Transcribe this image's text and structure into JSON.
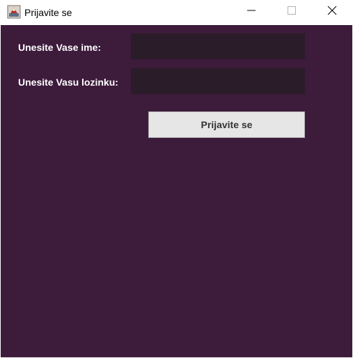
{
  "window": {
    "title": "Prijavite se",
    "icon": "java-app-icon",
    "controls": [
      "minimize-icon",
      "maximize-icon",
      "close-icon"
    ]
  },
  "form": {
    "name_label": "Unesite Vase ime:",
    "name_value": "",
    "password_label": "Unesite Vasu lozinku:",
    "password_value": "",
    "submit_label": "Prijavite se"
  },
  "colors": {
    "background": "#3d1b3b",
    "field_background": "#2a1c28",
    "button_background": "#e6e6e6",
    "label_text": "#ffffff"
  }
}
